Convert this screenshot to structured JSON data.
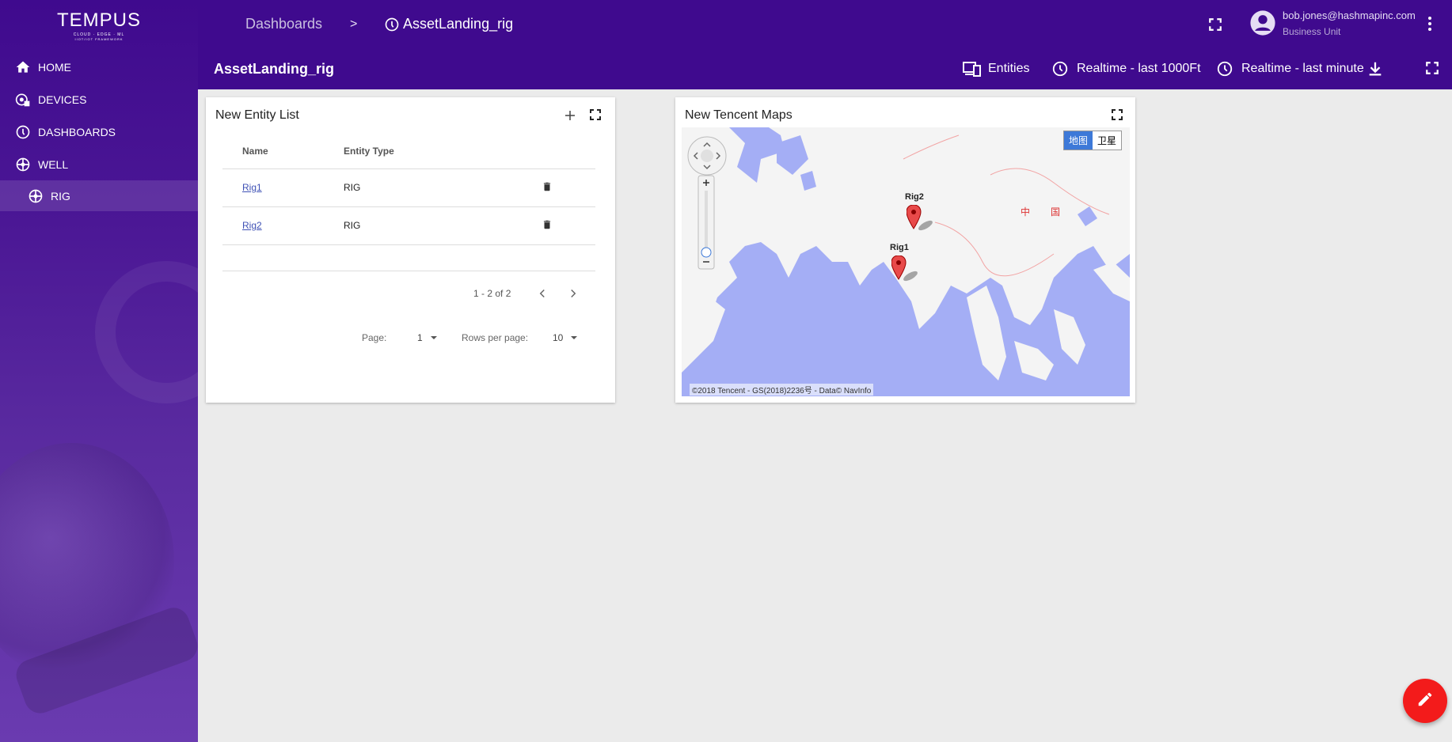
{
  "brand": {
    "name": "TEMPUS",
    "tagline": "CLOUD · EDGE · ML",
    "subtagline": "IIOT/IOT FRAMEWORK"
  },
  "sidebar": {
    "items": [
      {
        "label": "HOME",
        "icon": "home-icon"
      },
      {
        "label": "DEVICES",
        "icon": "devices-icon"
      },
      {
        "label": "DASHBOARDS",
        "icon": "dashboards-icon"
      },
      {
        "label": "WELL",
        "icon": "well-icon"
      },
      {
        "label": "RIG",
        "icon": "rig-icon"
      }
    ]
  },
  "header": {
    "breadcrumb_root": "Dashboards",
    "breadcrumb_sep": ">",
    "breadcrumb_current": "AssetLanding_rig",
    "user_email": "bob.jones@hashmapinc.com",
    "user_role": "Business Unit"
  },
  "toolbar": {
    "dashboard_title": "AssetLanding_rig",
    "entities_label": "Entities",
    "realtime_depth_label": "Realtime - last 1000Ft",
    "realtime_time_label": "Realtime - last minute"
  },
  "entity_widget": {
    "title": "New Entity List",
    "columns": [
      "Name",
      "Entity Type"
    ],
    "rows": [
      {
        "name": "Rig1",
        "type": "RIG"
      },
      {
        "name": "Rig2",
        "type": "RIG"
      }
    ],
    "range_text": "1 - 2 of 2",
    "page_label": "Page:",
    "page_value": "1",
    "rows_per_page_label": "Rows per page:",
    "rows_per_page_value": "10"
  },
  "map_widget": {
    "title": "New Tencent Maps",
    "map_type_map": "地图",
    "map_type_satellite": "卫星",
    "country_label_1": "中",
    "country_label_2": "国",
    "markers": [
      {
        "label": "Rig2"
      },
      {
        "label": "Rig1"
      }
    ],
    "copyright": "©2018 Tencent - GS(2018)2236号 - Data© NavInfo"
  },
  "colors": {
    "primary": "#3f0a8e",
    "fab": "#f31b1b",
    "link": "#3f51b5",
    "water": "#a4aef5"
  }
}
